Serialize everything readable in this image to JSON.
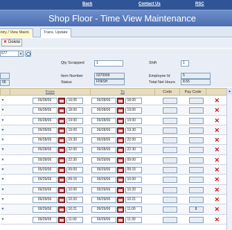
{
  "topnav": {
    "back": "Back",
    "contact": "Contact Us",
    "rsc": "RSC"
  },
  "page_title": "Shop Floor - Time View Maintenance",
  "tabs": [
    {
      "label": "Entry / View Maint."
    },
    {
      "label": "Trans. Update"
    }
  ],
  "toolbar": {
    "delete_label": "Delete"
  },
  "form": {
    "partial_select_value": "677",
    "qty_scrapped_label": "Qty Scrapped",
    "qty_scrapped_value": "1",
    "shift_label": "Shift",
    "shift_value": "1",
    "item_number_label": "Item Number",
    "item_number_value": "0370099",
    "status_label": "Status",
    "status_value": "FINISH",
    "employee_id_label": "Employee Id",
    "employee_id_value": "5",
    "total_net_hours_label": "Total Net Hours",
    "total_net_hours_value": "8.55",
    "left_partial_value": "06"
  },
  "grid": {
    "headers": {
      "from": "From",
      "to": "To",
      "code": "Code",
      "pay_code": "Pay Code"
    },
    "rows": [
      {
        "from_date": "09/28/06",
        "from_time": "16:05",
        "to_date": "09/28/06",
        "to_time": "18:00",
        "code": "",
        "pay_code": ""
      },
      {
        "from_date": "09/28/06",
        "from_time": "18:00",
        "to_date": "09/28/06",
        "to_time": "19:00",
        "code": "",
        "pay_code": ""
      },
      {
        "from_date": "09/28/06",
        "from_time": "19:00",
        "to_date": "09/28/06",
        "to_time": "19:00",
        "code": "",
        "pay_code": ""
      },
      {
        "from_date": "09/28/06",
        "from_time": "19:00",
        "to_date": "09/28/06",
        "to_time": "19:30",
        "code": "",
        "pay_code": ""
      },
      {
        "from_date": "09/28/06",
        "from_time": "19:30",
        "to_date": "09/28/06",
        "to_time": "22:00",
        "code": "",
        "pay_code": ""
      },
      {
        "from_date": "09/28/06",
        "from_time": "22:00",
        "to_date": "09/28/06",
        "to_time": "22:30",
        "code": "",
        "pay_code": ""
      },
      {
        "from_date": "09/28/06",
        "from_time": "22:30",
        "to_date": "09/29/06",
        "to_time": "09:00",
        "code": "",
        "pay_code": ""
      },
      {
        "from_date": "09/29/06",
        "from_time": "09:00",
        "to_date": "09/29/06",
        "to_time": "09:15",
        "code": "",
        "pay_code": ""
      },
      {
        "from_date": "09/29/06",
        "from_time": "09:15",
        "to_date": "09/29/06",
        "to_time": "10:00",
        "code": "",
        "pay_code": ""
      },
      {
        "from_date": "09/29/06",
        "from_time": "10:00",
        "to_date": "09/29/06",
        "to_time": "10:20",
        "code": "",
        "pay_code": ""
      },
      {
        "from_date": "09/29/06",
        "from_time": "10:20",
        "to_date": "09/29/06",
        "to_time": "10:21",
        "code": "",
        "pay_code": ""
      },
      {
        "from_date": "09/29/06",
        "from_time": "10:21",
        "to_date": "09/29/06",
        "to_time": "11:00",
        "code": "",
        "pay_code": "8"
      },
      {
        "from_date": "09/29/06",
        "from_time": "11:00",
        "to_date": "09/29/06",
        "to_time": "11:30",
        "code": "",
        "pay_code": ""
      }
    ]
  }
}
